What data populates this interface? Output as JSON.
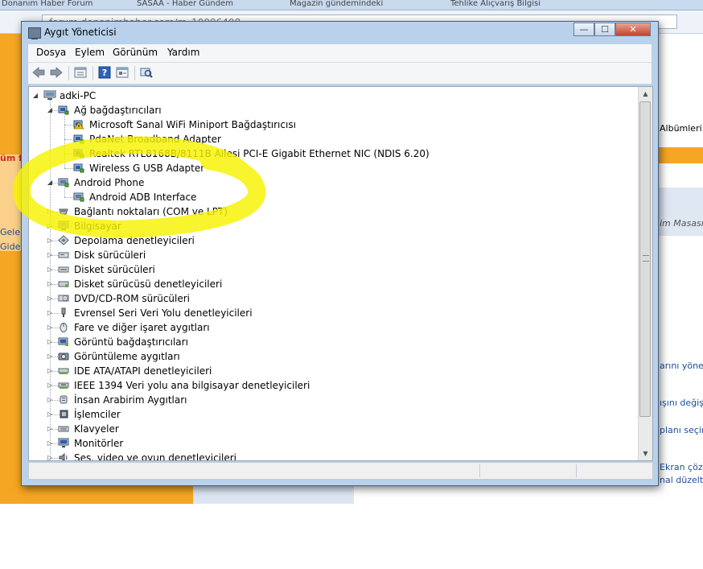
{
  "browser": {
    "tabs": [
      "Donanım Haber Forum",
      "SASAA - Haber Gündem",
      "Magazin gündemindeki",
      "Tehlike Alıçvarış Bilgisi"
    ],
    "url": "forum.donanimhaber.com/m_10096408",
    "left_links": [
      "Geler",
      "Gider"
    ],
    "left_label": "üm f",
    "right_texts": [
      "Albümleri",
      "im Masası",
      "arını yönet",
      "ışını değiş",
      "planı seçin",
      "Ekran çözü",
      "nal düzeltili"
    ]
  },
  "window": {
    "title": "Aygıt Yöneticisi",
    "controls": {
      "minimize": "—",
      "maximize": "☐",
      "close": "✕"
    }
  },
  "menu": [
    "Dosya",
    "Eylem",
    "Görünüm",
    "Yardım"
  ],
  "toolbar": [
    {
      "icon": "back-arrow-icon"
    },
    {
      "icon": "forward-arrow-icon"
    },
    {
      "icon": "properties-icon"
    },
    {
      "icon": "help-icon"
    },
    {
      "icon": "update-driver-icon"
    },
    {
      "icon": "scan-hardware-icon"
    }
  ],
  "tree": {
    "root": "adki-PC",
    "items": [
      {
        "label": "Ağ bağdaştırıcıları",
        "level": 1,
        "expanded": true,
        "icon": "network-adapter-icon",
        "disabled": false
      },
      {
        "label": "Microsoft Sanal WiFi Miniport Bağdaştırıcısı",
        "level": 2,
        "icon": "network-warning-icon",
        "disabled": false
      },
      {
        "label": "PdaNet Broadband Adapter",
        "level": 2,
        "icon": "network-adapter-icon",
        "disabled": false
      },
      {
        "label": "Realtek RTL8168B/8111B Ailesi PCI-E Gigabit Ethernet NIC (NDIS 6.20)",
        "level": 2,
        "icon": "network-adapter-icon",
        "disabled": false
      },
      {
        "label": "Wireless G USB Adapter",
        "level": 2,
        "icon": "network-adapter-icon",
        "disabled": false
      },
      {
        "label": "Android Phone",
        "level": 1,
        "expanded": true,
        "icon": "phone-device-icon",
        "disabled": false
      },
      {
        "label": "Android ADB Interface",
        "level": 2,
        "icon": "phone-device-icon",
        "disabled": false
      },
      {
        "label": "Bağlantı noktaları (COM ve LPT)",
        "level": 1,
        "expanded": false,
        "icon": "port-icon",
        "disabled": false
      },
      {
        "label": "Bilgisayar",
        "level": 1,
        "expanded": false,
        "icon": "computer-icon",
        "disabled": false
      },
      {
        "label": "Depolama denetleyicileri",
        "level": 1,
        "expanded": false,
        "icon": "storage-controller-icon",
        "disabled": false
      },
      {
        "label": "Disk sürücüleri",
        "level": 1,
        "expanded": false,
        "icon": "disk-drive-icon",
        "disabled": false
      },
      {
        "label": "Disket sürücüleri",
        "level": 1,
        "expanded": false,
        "icon": "floppy-drive-icon",
        "disabled": false
      },
      {
        "label": "Disket sürücüsü denetleyicileri",
        "level": 1,
        "expanded": false,
        "icon": "floppy-controller-icon",
        "disabled": false
      },
      {
        "label": "DVD/CD-ROM sürücüleri",
        "level": 1,
        "expanded": false,
        "icon": "dvd-drive-icon",
        "disabled": false
      },
      {
        "label": "Evrensel Seri Veri Yolu denetleyicileri",
        "level": 1,
        "expanded": false,
        "icon": "usb-controller-icon",
        "disabled": false
      },
      {
        "label": "Fare ve diğer işaret aygıtları",
        "level": 1,
        "expanded": false,
        "icon": "mouse-icon",
        "disabled": false
      },
      {
        "label": "Görüntü bağdaştırıcıları",
        "level": 1,
        "expanded": false,
        "icon": "display-adapter-icon",
        "disabled": false
      },
      {
        "label": "Görüntüleme aygıtları",
        "level": 1,
        "expanded": false,
        "icon": "imaging-device-icon",
        "disabled": false
      },
      {
        "label": "IDE ATA/ATAPI denetleyicileri",
        "level": 1,
        "expanded": false,
        "icon": "ide-controller-icon",
        "disabled": false
      },
      {
        "label": "IEEE 1394 Veri yolu ana bilgisayar denetleyicileri",
        "level": 1,
        "expanded": false,
        "icon": "firewire-icon",
        "disabled": false
      },
      {
        "label": "İnsan Arabirim Aygıtları",
        "level": 1,
        "expanded": false,
        "icon": "hid-icon",
        "disabled": false
      },
      {
        "label": "İşlemciler",
        "level": 1,
        "expanded": false,
        "icon": "processor-icon",
        "disabled": false
      },
      {
        "label": "Klavyeler",
        "level": 1,
        "expanded": false,
        "icon": "keyboard-icon",
        "disabled": false
      },
      {
        "label": "Monitörler",
        "level": 1,
        "expanded": false,
        "icon": "monitor-icon",
        "disabled": false
      },
      {
        "label": "Ses, video ve oyun denetleyicileri",
        "level": 1,
        "expanded": false,
        "icon": "sound-icon",
        "disabled": false
      }
    ]
  },
  "colors": {
    "highlighter": "#f6f200",
    "window_frame": "#b9d1ea",
    "browser_orange": "#f5a623"
  }
}
